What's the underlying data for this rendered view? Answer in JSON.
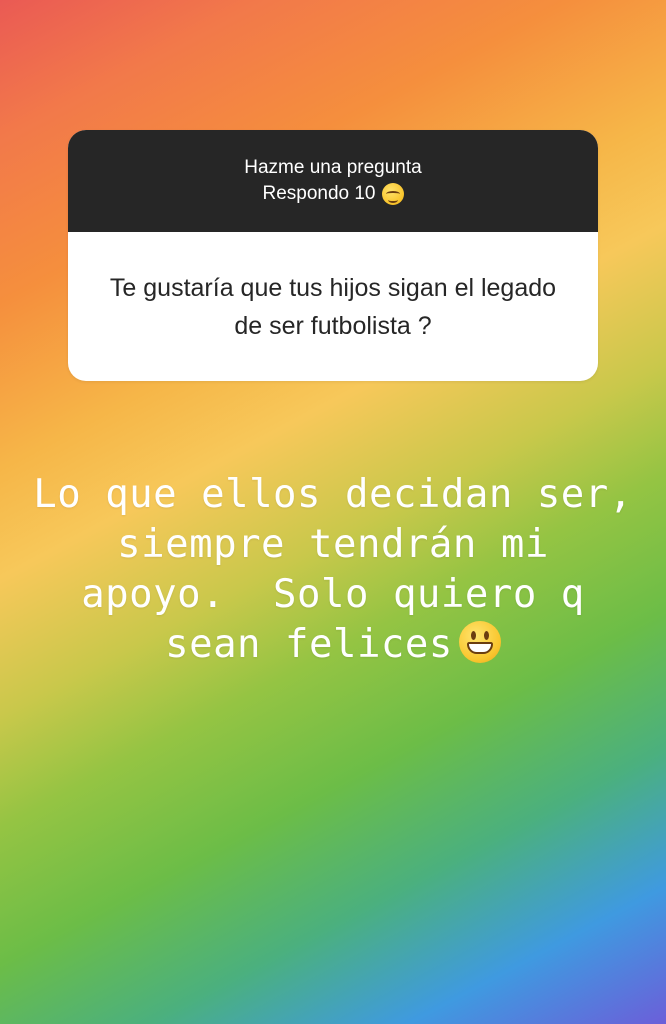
{
  "question_sticker": {
    "header_line1": "Hazme una pregunta",
    "header_line2": "Respondo 10",
    "header_emoji": "relieved-face-emoji",
    "question": "Te gustaría que tus hijos sigan el legado de ser futbolista ?"
  },
  "answer": {
    "lines": [
      "Lo que ellos decidan ser,",
      "siempre tendrán mi",
      "apoyo.  Solo quiero q",
      "sean felices"
    ],
    "trailing_emoji": "grinning-face-emoji"
  },
  "background": {
    "style": "rainbow-gradient",
    "colors": [
      "#ea5a54",
      "#f58f3d",
      "#f7c85a",
      "#95c443",
      "#6cbd47",
      "#3f9ae0",
      "#6b5fd9"
    ]
  }
}
